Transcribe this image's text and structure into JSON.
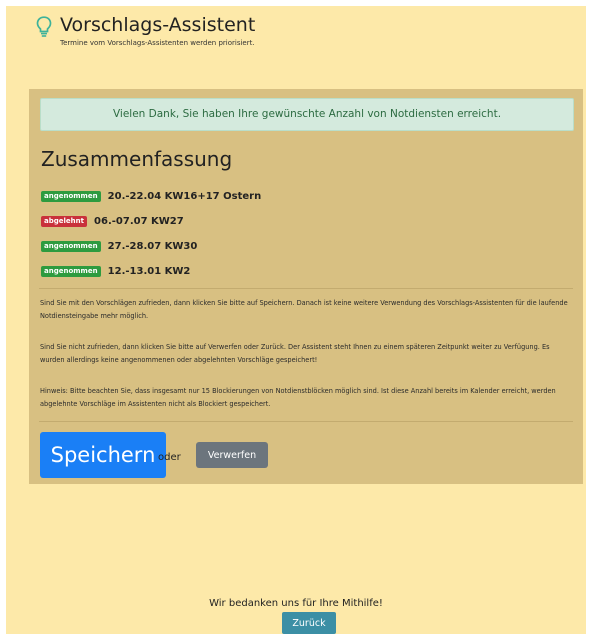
{
  "header": {
    "icon": "lightbulb-icon",
    "icon_color": "#3db29a",
    "title": "Vorschlags-Assistent",
    "subtitle": "Termine vom Vorschlags-Assistenten werden priorisiert."
  },
  "alert": {
    "text": "Vielen Dank, Sie haben Ihre gewünschte Anzahl von Notdiensten erreicht."
  },
  "summary": {
    "heading": "Zusammenfassung",
    "items": [
      {
        "status": "angenommen",
        "status_color": "#2e9b3f",
        "text": "20.-22.04 KW16+17 Ostern"
      },
      {
        "status": "abgelehnt",
        "status_color": "#c9313b",
        "text": "06.-07.07 KW27"
      },
      {
        "status": "angenommen",
        "status_color": "#2e9b3f",
        "text": "27.-28.07 KW30"
      },
      {
        "status": "angenommen",
        "status_color": "#2e9b3f",
        "text": "12.-13.01 KW2"
      }
    ]
  },
  "info": {
    "para1": "Sind Sie mit den Vorschlägen zufrieden, dann klicken Sie bitte auf Speichern. Danach ist keine weitere Verwendung des Vorschlags-Assistenten für die laufende Notdiensteingabe mehr möglich.",
    "para2": "Sind Sie nicht zufrieden, dann klicken Sie bitte auf Verwerfen oder Zurück. Der Assistent steht Ihnen zu einem späteren Zeitpunkt weiter zu Verfügung. Es wurden allerdings keine angenommenen oder abgelehnten Vorschläge gespeichert!",
    "para3": "Hinweis: Bitte beachten Sie, dass insgesamt nur 15 Blockierungen von Notdienstblöcken möglich sind. Ist diese Anzahl bereits im Kalender erreicht, werden abgelehnte Vorschläge im Assistenten nicht als Blockiert gespeichert."
  },
  "actions": {
    "save_label": "Speichern",
    "or_label": "oder",
    "discard_label": "Verwerfen"
  },
  "footer": {
    "thanks": "Wir bedanken uns für Ihre Mithilfe!",
    "back_label": "Zurück"
  }
}
